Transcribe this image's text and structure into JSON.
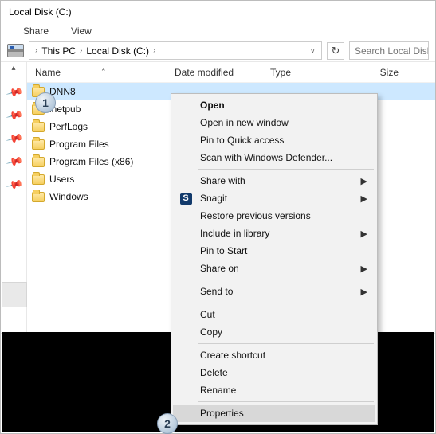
{
  "title": "Local Disk (C:)",
  "menubar": {
    "share": "Share",
    "view": "View"
  },
  "breadcrumb": {
    "pc": "This PC",
    "disk": "Local Disk (C:)"
  },
  "search_placeholder": "Search Local Disk",
  "columns": {
    "name": "Name",
    "date": "Date modified",
    "type": "Type",
    "size": "Size"
  },
  "folders": [
    {
      "label": "DNN8"
    },
    {
      "label": "inetpub"
    },
    {
      "label": "PerfLogs"
    },
    {
      "label": "Program Files"
    },
    {
      "label": "Program Files (x86)"
    },
    {
      "label": "Users"
    },
    {
      "label": "Windows"
    }
  ],
  "status": "selected",
  "badge1": "1",
  "badge2": "2",
  "context_menu": {
    "open": "Open",
    "open_new": "Open in new window",
    "pin_quick": "Pin to Quick access",
    "scan": "Scan with Windows Defender...",
    "share_with": "Share with",
    "snagit": "Snagit",
    "restore": "Restore previous versions",
    "include": "Include in library",
    "pin_start": "Pin to Start",
    "share_on": "Share on",
    "send_to": "Send to",
    "cut": "Cut",
    "copy": "Copy",
    "shortcut": "Create shortcut",
    "delete": "Delete",
    "rename": "Rename",
    "properties": "Properties"
  },
  "snagit_icon_letter": "S"
}
